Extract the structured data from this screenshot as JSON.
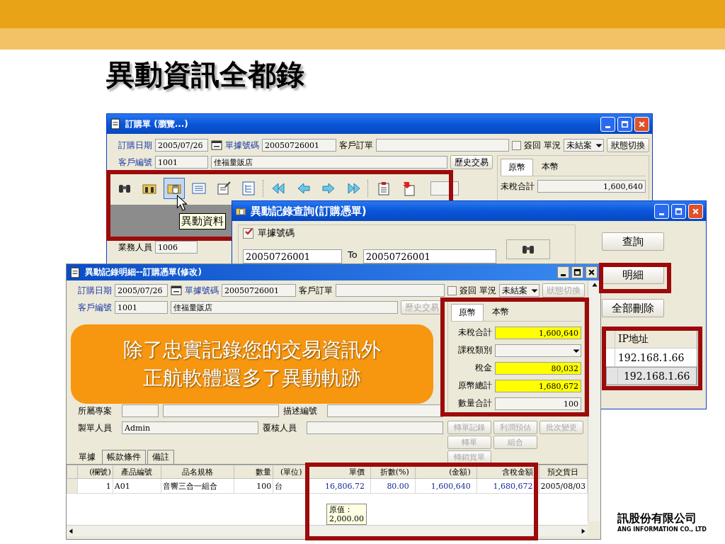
{
  "slide": {
    "title": "異動資訊全都錄",
    "callout": [
      "除了忠實記錄您的交易資訊外",
      "正航軟體還多了異動軌跡"
    ],
    "logo_name": "訊股份有限公司",
    "logo_english": "ANG INFORMATION CO., LTD"
  },
  "order_window": {
    "title": "訂購單 (瀏覽...)",
    "header_row": {
      "date_label": {
        "text": "訂購日期",
        "required": true
      },
      "date": "2005/07/26",
      "number_label": {
        "text": "單據號碼",
        "required": true
      },
      "number": "20050726001",
      "customer_order_label": "客戶訂單",
      "signed_checked": false,
      "signed_label": "簽回",
      "status_label": "單況",
      "status": "未結案",
      "status_button": {
        "label": "狀態切換",
        "disabled": false
      }
    },
    "customer_row": {
      "label": {
        "text": "客戶編號",
        "required": true
      },
      "code": "1001",
      "name": "佳福量販店",
      "history_button": {
        "label": "歷史交易",
        "disabled": false
      }
    },
    "toolbar": [
      {
        "kind": "binoculars",
        "selected": false
      },
      {
        "kind": "folder-binoculars",
        "selected": false
      },
      {
        "kind": "folder-hand",
        "selected": true
      },
      {
        "kind": "list",
        "selected": false
      },
      {
        "kind": "form-edit",
        "selected": false
      },
      {
        "kind": "tree-list",
        "selected": false
      },
      {
        "kind": "double-left-arrow",
        "selected": false
      },
      {
        "kind": "left-arrow",
        "selected": false
      },
      {
        "kind": "right-arrow",
        "selected": false
      },
      {
        "kind": "double-right-arrow",
        "selected": false
      },
      {
        "kind": "clipboard",
        "selected": false
      },
      {
        "kind": "document-arrow",
        "selected": false
      }
    ],
    "tooltip": "異動資料",
    "sales_label": "業務人員",
    "sales_value": "1006",
    "currency_tabs": [
      {
        "label": "原幣",
        "selected": true
      },
      {
        "label": "本幣",
        "selected": false
      }
    ],
    "subtotal_label": "未稅合計",
    "subtotal": "1,600,640"
  },
  "query_window": {
    "title": "異動記錄查詢(訂購憑單)",
    "group_label": "單據號碼",
    "group_checked": true,
    "from": "20050726001",
    "to_label": "To",
    "to": "20050726001",
    "buttons": [
      "查詢",
      "明細",
      "全部刪除"
    ],
    "grid": {
      "column": "IP地址",
      "rows": [
        {
          "value": "192.168.1.66",
          "selected": false
        },
        {
          "value": "192.168.1.66",
          "selected": true
        }
      ]
    }
  },
  "detail_window": {
    "title": "異動記錄明細--訂購憑單(修改)",
    "header_row": {
      "date_label": {
        "text": "訂購日期",
        "required": true
      },
      "date": "2005/07/26",
      "number_label": {
        "text": "單據號碼",
        "required": true
      },
      "number": "20050726001",
      "customer_order_label": "客戶訂單",
      "signed_checked": false,
      "signed_label": "簽回",
      "status_label": "單況",
      "status": "未結案",
      "status_button": {
        "label": "狀態切換",
        "disabled": true
      }
    },
    "customer_row": {
      "label": {
        "text": "客戶編號",
        "required": true
      },
      "code": "1001",
      "name": "佳福量販店",
      "history_button": {
        "label": "歷史交易",
        "disabled": true
      }
    },
    "left_rows": [
      [
        {
          "label": "所屬專案",
          "kind": "split"
        },
        {
          "label": "描述編號",
          "kind": "single"
        }
      ],
      [
        {
          "label": "製單人員",
          "kind": "single",
          "value": "Admin"
        },
        {
          "label": "覆核人員",
          "kind": "single"
        }
      ]
    ],
    "currency_tabs": [
      {
        "label": "原幣",
        "selected": true
      },
      {
        "label": "本幣",
        "selected": false
      }
    ],
    "totals": [
      {
        "label": "未稅合計",
        "kind": "field",
        "value": "1,600,640",
        "highlighted": true
      },
      {
        "label": "課稅類別",
        "kind": "dropdown"
      },
      {
        "label": "稅金",
        "kind": "field",
        "value": "80,032",
        "highlighted": true
      },
      {
        "label": "原幣總計",
        "kind": "field",
        "value": "1,680,672",
        "highlighted": true
      },
      {
        "label": "數量合計",
        "kind": "field",
        "value": "100",
        "highlighted": false
      }
    ],
    "action_rows": [
      [
        {
          "label": "轉單記錄",
          "disabled": true
        },
        {
          "label": "利潤預估",
          "disabled": true
        },
        {
          "label": "批次變更",
          "disabled": true
        }
      ],
      [
        {
          "label": "轉單",
          "disabled": true
        },
        {
          "label": "組合",
          "disabled": true
        }
      ],
      [
        {
          "label": "轉銷貨單",
          "disabled": true
        }
      ]
    ],
    "tabs": [
      {
        "label": "單據",
        "selected": true
      },
      {
        "label": "帳款條件",
        "selected": false
      },
      {
        "label": "備註",
        "selected": false
      }
    ],
    "grid": {
      "columns": [
        {
          "label": "(欄號)",
          "kind": "number"
        },
        {
          "label": "產品編號",
          "kind": "text"
        },
        {
          "label": "品名規格",
          "kind": "text"
        },
        {
          "label": "數量",
          "kind": "number"
        },
        {
          "label": "(單位)",
          "kind": "text"
        },
        {
          "label": "單價",
          "kind": "amount"
        },
        {
          "label": "折數(%)",
          "kind": "amount"
        },
        {
          "label": "(金額)",
          "kind": "amount"
        },
        {
          "label": "含稅金額",
          "kind": "amount"
        },
        {
          "label": "預交貨日",
          "kind": "text"
        }
      ],
      "rows": [
        [
          "1",
          "A01",
          "音響三合一組合",
          "100",
          "台",
          "16,806.72",
          "80.00",
          "1,600,640",
          "1,680,672",
          "2005/08/03"
        ]
      ],
      "tooltip_label": "原值：",
      "tooltip_value": "2,000.00"
    }
  }
}
